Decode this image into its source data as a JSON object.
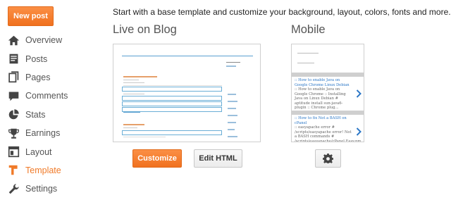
{
  "sidebar": {
    "new_post_label": "New post",
    "items": [
      {
        "label": "Overview",
        "icon": "home-icon"
      },
      {
        "label": "Posts",
        "icon": "posts-icon"
      },
      {
        "label": "Pages",
        "icon": "pages-icon"
      },
      {
        "label": "Comments",
        "icon": "comment-icon"
      },
      {
        "label": "Stats",
        "icon": "pie-chart-icon"
      },
      {
        "label": "Earnings",
        "icon": "trophy-icon"
      },
      {
        "label": "Layout",
        "icon": "layout-icon"
      },
      {
        "label": "Template",
        "icon": "template-icon",
        "active": true
      },
      {
        "label": "Settings",
        "icon": "wrench-icon"
      }
    ]
  },
  "main": {
    "intro": "Start with a base template and customize your background, layout, colors, fonts and more...",
    "live_title": "Live on Blog",
    "mobile_title": "Mobile",
    "customize_label": "Customize",
    "edit_html_label": "Edit HTML",
    "mobile_posts": [
      {
        "title": ":: How to enable Java on Google Chrome Linux Debian",
        "body": ":: How to enable Java on Google Chrome :: Installing Java on Linux Debian # aptitude install sun-java6-plugin :: Chrome plug..."
      },
      {
        "title": ":: How to fix Not a BASH on cPanel",
        "body": ":: easyapache error # /scripts/easyapache error! Not a BASH commands # /scripts/easyapache/cPanel.Easy.pm line 349 :: How to fix..."
      }
    ]
  },
  "colors": {
    "accent": "#f07a28",
    "link": "#2a76c6"
  }
}
